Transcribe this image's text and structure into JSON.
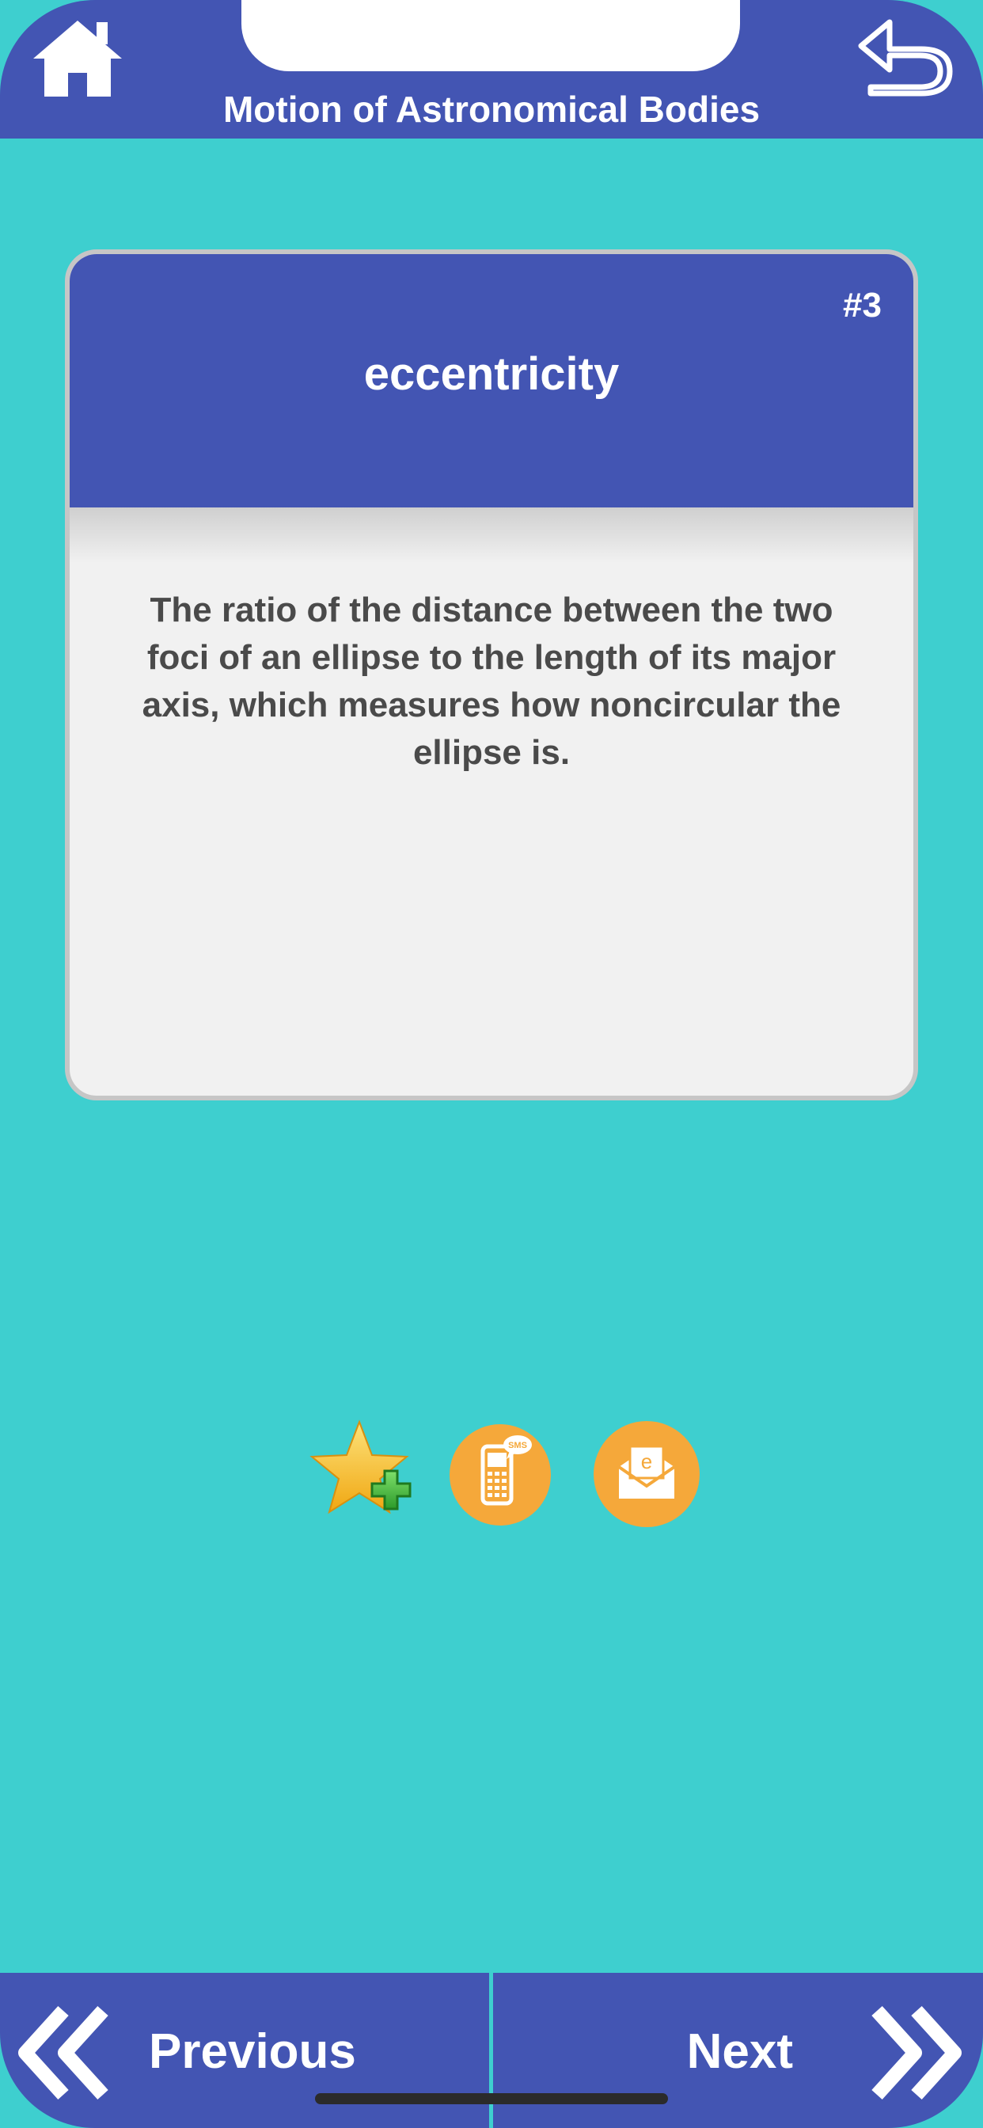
{
  "header": {
    "title": "Motion of Astronomical Bodies"
  },
  "card": {
    "number": "#3",
    "term": "eccentricity",
    "definition": "The ratio of the distance between the two foci of an ellipse to the length of its major axis, which measures how noncircular the ellipse is."
  },
  "actions": {
    "sms_badge": "SMS",
    "email_badge": "e"
  },
  "nav": {
    "previous_label": "Previous",
    "next_label": "Next"
  },
  "colors": {
    "background": "#3ecfcf",
    "bar": "#4355b3",
    "card": "#f1f1f1",
    "accent_orange": "#f5a83a",
    "star": "#f7c31c",
    "plus": "#3fb43a"
  },
  "icons": {
    "home": "home-icon",
    "back": "back-arrow-icon",
    "favorite": "star-plus-icon",
    "sms": "sms-phone-icon",
    "email": "email-envelope-icon",
    "previous": "double-chevron-left-icon",
    "next": "double-chevron-right-icon"
  }
}
